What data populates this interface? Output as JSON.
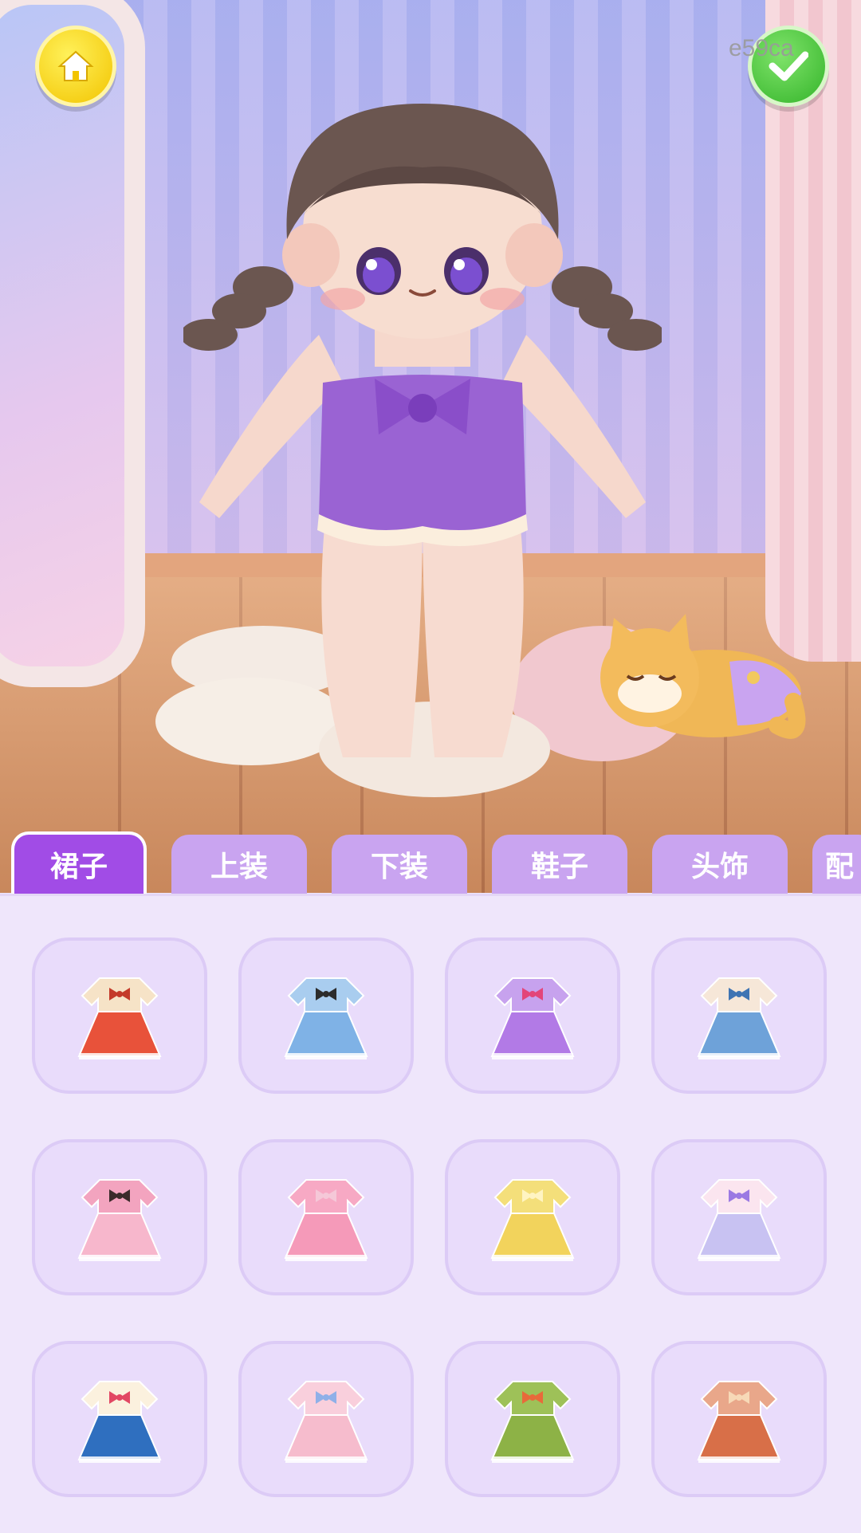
{
  "watermark": "e59ca",
  "header": {
    "home_icon": "home-icon",
    "confirm_icon": "check-icon",
    "home_color": "#f2c400",
    "confirm_color": "#34b42a"
  },
  "tabs": [
    {
      "label": "裙子",
      "active": true
    },
    {
      "label": "上装",
      "active": false
    },
    {
      "label": "下装",
      "active": false
    },
    {
      "label": "鞋子",
      "active": false
    },
    {
      "label": "头饰",
      "active": false
    },
    {
      "label": "配",
      "active": false
    }
  ],
  "outfits": [
    {
      "icon": "cream-red-dress-icon",
      "top": "#f6e3c7",
      "skirt": "#e8523a",
      "accent": "#c43a2a"
    },
    {
      "icon": "blue-plaid-dress-icon",
      "top": "#a9cdef",
      "skirt": "#7fb2e6",
      "accent": "#2c2c2c"
    },
    {
      "icon": "purple-dress-icon",
      "top": "#c7a2ee",
      "skirt": "#b27ae6",
      "accent": "#e3457a"
    },
    {
      "icon": "denim-overalls-icon",
      "top": "#f6e7d8",
      "skirt": "#6ea2d9",
      "accent": "#3f74b3"
    },
    {
      "icon": "pink-dress-icon",
      "top": "#f3a4bf",
      "skirt": "#f7b7cc",
      "accent": "#3b2a2a"
    },
    {
      "icon": "pink-slip-dress-icon",
      "top": "#f7a9c4",
      "skirt": "#f59ab9",
      "accent": "#f5c8d8"
    },
    {
      "icon": "yellow-outfit-icon",
      "top": "#f4df7a",
      "skirt": "#f2d35c",
      "accent": "#fff4c2"
    },
    {
      "icon": "pastel-rainbow-dress-icon",
      "top": "#fbe5ef",
      "skirt": "#c8c2f2",
      "accent": "#9b7ae3"
    },
    {
      "icon": "sailor-dress-icon",
      "top": "#fbf1de",
      "skirt": "#2f6fbf",
      "accent": "#e24763"
    },
    {
      "icon": "pink-lace-dress-icon",
      "top": "#f9cfdc",
      "skirt": "#f6bccd",
      "accent": "#8fb0e8"
    },
    {
      "icon": "green-qipao-icon",
      "top": "#9ec158",
      "skirt": "#8db246",
      "accent": "#e86a3a"
    },
    {
      "icon": "rust-lace-dress-icon",
      "top": "#e9a78a",
      "skirt": "#d86f48",
      "accent": "#f7d9b7"
    }
  ]
}
